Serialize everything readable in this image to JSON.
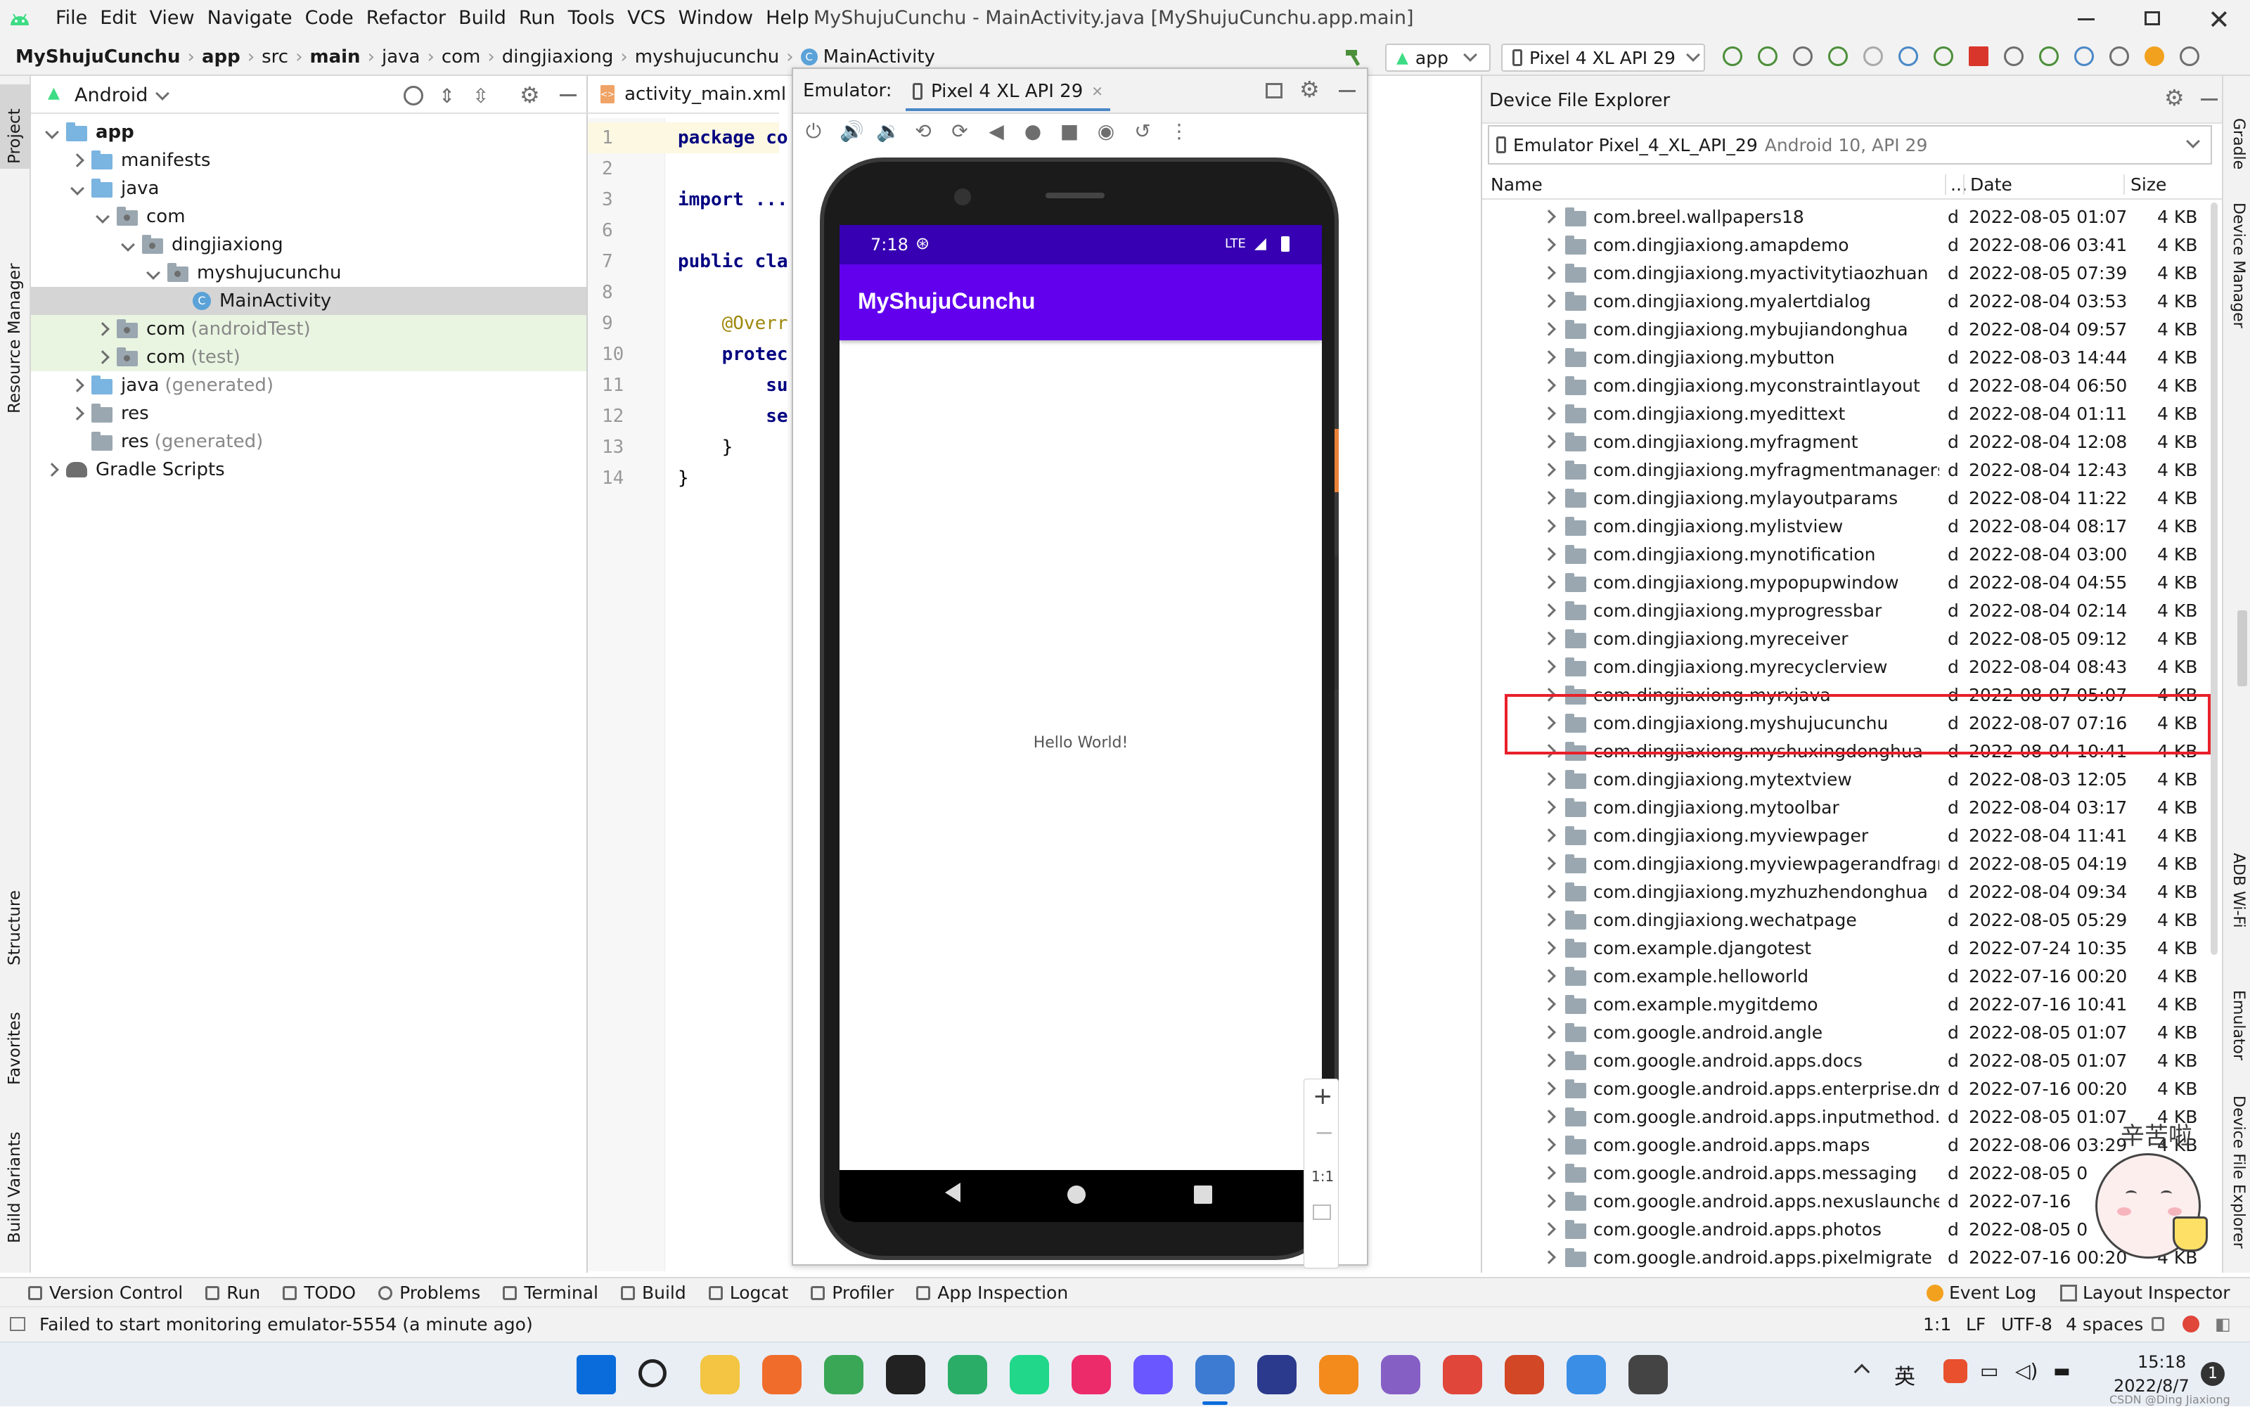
{
  "window": {
    "title": "MyShujuCunchu - MainActivity.java [MyShujuCunchu.app.main]",
    "menus": [
      "File",
      "Edit",
      "View",
      "Navigate",
      "Code",
      "Refactor",
      "Build",
      "Run",
      "Tools",
      "VCS",
      "Window",
      "Help"
    ]
  },
  "breadcrumb": [
    "MyShujuCunchu",
    "app",
    "src",
    "main",
    "java",
    "com",
    "dingjiaxiong",
    "myshujucunchu",
    "MainActivity"
  ],
  "toolbar": {
    "run_config": "app",
    "device": "Pixel 4 XL API 29"
  },
  "left_strip": [
    "Project",
    "Resource Manager",
    "Structure",
    "Favorites",
    "Build Variants"
  ],
  "right_strip": [
    "Gradle",
    "Device Manager",
    "ADB Wi-Fi",
    "Emulator",
    "Device File Explorer"
  ],
  "project": {
    "view": "Android",
    "tree": [
      {
        "label": "app",
        "depth": 0,
        "expanded": true,
        "icon": "folder-module",
        "bold": true
      },
      {
        "label": "manifests",
        "depth": 1,
        "expanded": false,
        "icon": "folder-blue"
      },
      {
        "label": "java",
        "depth": 1,
        "expanded": true,
        "icon": "folder-blue"
      },
      {
        "label": "com",
        "depth": 2,
        "expanded": true,
        "icon": "package"
      },
      {
        "label": "dingjiaxiong",
        "depth": 3,
        "expanded": true,
        "icon": "package"
      },
      {
        "label": "myshujucunchu",
        "depth": 4,
        "expanded": true,
        "icon": "package"
      },
      {
        "label": "MainActivity",
        "depth": 5,
        "icon": "class",
        "selected": true
      },
      {
        "label": "com",
        "suffix": "(androidTest)",
        "depth": 2,
        "expanded": false,
        "icon": "package",
        "green": true
      },
      {
        "label": "com",
        "suffix": "(test)",
        "depth": 2,
        "expanded": false,
        "icon": "package",
        "green": true
      },
      {
        "label": "java",
        "suffix": "(generated)",
        "depth": 1,
        "expanded": false,
        "icon": "folder-blue"
      },
      {
        "label": "res",
        "depth": 1,
        "expanded": false,
        "icon": "folder-res"
      },
      {
        "label": "res",
        "suffix": "(generated)",
        "depth": 1,
        "icon": "folder-res"
      },
      {
        "label": "Gradle Scripts",
        "depth": 0,
        "expanded": false,
        "icon": "gradle"
      }
    ]
  },
  "editor": {
    "tab": "activity_main.xml",
    "lines": [
      {
        "n": "1",
        "html": "package co"
      },
      {
        "n": "2",
        "html": ""
      },
      {
        "n": "3",
        "html": "import ..."
      },
      {
        "n": "6",
        "html": ""
      },
      {
        "n": "7",
        "html": "public cla"
      },
      {
        "n": "8",
        "html": ""
      },
      {
        "n": "9",
        "html": "    @Overr"
      },
      {
        "n": "10",
        "html": "    protec"
      },
      {
        "n": "11",
        "html": "        su"
      },
      {
        "n": "12",
        "html": "        se"
      },
      {
        "n": "13",
        "html": "    }"
      },
      {
        "n": "14",
        "html": "}"
      }
    ]
  },
  "emulator": {
    "label": "Emulator:",
    "tab": "Pixel 4 XL API 29",
    "time": "7:18",
    "network": "LTE",
    "app_title": "MyShujuCunchu",
    "content": "Hello World!",
    "zoom_label": "1:1"
  },
  "device_explorer": {
    "title": "Device File Explorer",
    "device": "Emulator Pixel_4_XL_API_29",
    "device_detail": "Android 10, API 29",
    "columns": {
      "name": "Name",
      "perm": "...",
      "date": "Date",
      "size": "Size"
    },
    "rows": [
      {
        "name": "com.breel.wallpapers18",
        "perm": "d",
        "date": "2022-08-05 01:07",
        "size": "4 KB"
      },
      {
        "name": "com.dingjiaxiong.amapdemo",
        "perm": "d",
        "date": "2022-08-06 03:41",
        "size": "4 KB"
      },
      {
        "name": "com.dingjiaxiong.myactivitytiaozhuan",
        "perm": "d",
        "date": "2022-08-05 07:39",
        "size": "4 KB"
      },
      {
        "name": "com.dingjiaxiong.myalertdialog",
        "perm": "d",
        "date": "2022-08-04 03:53",
        "size": "4 KB"
      },
      {
        "name": "com.dingjiaxiong.mybujiandonghua",
        "perm": "d",
        "date": "2022-08-04 09:57",
        "size": "4 KB"
      },
      {
        "name": "com.dingjiaxiong.mybutton",
        "perm": "d",
        "date": "2022-08-03 14:44",
        "size": "4 KB"
      },
      {
        "name": "com.dingjiaxiong.myconstraintlayout",
        "perm": "d",
        "date": "2022-08-04 06:50",
        "size": "4 KB"
      },
      {
        "name": "com.dingjiaxiong.myedittext",
        "perm": "d",
        "date": "2022-08-04 01:11",
        "size": "4 KB"
      },
      {
        "name": "com.dingjiaxiong.myfragment",
        "perm": "d",
        "date": "2022-08-04 12:08",
        "size": "4 KB"
      },
      {
        "name": "com.dingjiaxiong.myfragmentmanagers",
        "perm": "d",
        "date": "2022-08-04 12:43",
        "size": "4 KB"
      },
      {
        "name": "com.dingjiaxiong.mylayoutparams",
        "perm": "d",
        "date": "2022-08-04 11:22",
        "size": "4 KB"
      },
      {
        "name": "com.dingjiaxiong.mylistview",
        "perm": "d",
        "date": "2022-08-04 08:17",
        "size": "4 KB"
      },
      {
        "name": "com.dingjiaxiong.mynotification",
        "perm": "d",
        "date": "2022-08-04 03:00",
        "size": "4 KB"
      },
      {
        "name": "com.dingjiaxiong.mypopupwindow",
        "perm": "d",
        "date": "2022-08-04 04:55",
        "size": "4 KB"
      },
      {
        "name": "com.dingjiaxiong.myprogressbar",
        "perm": "d",
        "date": "2022-08-04 02:14",
        "size": "4 KB"
      },
      {
        "name": "com.dingjiaxiong.myreceiver",
        "perm": "d",
        "date": "2022-08-05 09:12",
        "size": "4 KB"
      },
      {
        "name": "com.dingjiaxiong.myrecyclerview",
        "perm": "d",
        "date": "2022-08-04 08:43",
        "size": "4 KB"
      },
      {
        "name": "com.dingjiaxiong.myrxjava",
        "perm": "d",
        "date": "2022-08-07 05:07",
        "size": "4 KB"
      },
      {
        "name": "com.dingjiaxiong.myshujucunchu",
        "perm": "d",
        "date": "2022-08-07 07:16",
        "size": "4 KB",
        "highlight": true
      },
      {
        "name": "com.dingjiaxiong.myshuxingdonghua",
        "perm": "d",
        "date": "2022-08-04 10:41",
        "size": "4 KB"
      },
      {
        "name": "com.dingjiaxiong.mytextview",
        "perm": "d",
        "date": "2022-08-03 12:05",
        "size": "4 KB"
      },
      {
        "name": "com.dingjiaxiong.mytoolbar",
        "perm": "d",
        "date": "2022-08-04 03:17",
        "size": "4 KB"
      },
      {
        "name": "com.dingjiaxiong.myviewpager",
        "perm": "d",
        "date": "2022-08-04 11:41",
        "size": "4 KB"
      },
      {
        "name": "com.dingjiaxiong.myviewpagerandfragmen",
        "perm": "d",
        "date": "2022-08-05 04:19",
        "size": "4 KB"
      },
      {
        "name": "com.dingjiaxiong.myzhuzhendonghua",
        "perm": "d",
        "date": "2022-08-04 09:34",
        "size": "4 KB"
      },
      {
        "name": "com.dingjiaxiong.wechatpage",
        "perm": "d",
        "date": "2022-08-05 05:29",
        "size": "4 KB"
      },
      {
        "name": "com.example.djangotest",
        "perm": "d",
        "date": "2022-07-24 10:35",
        "size": "4 KB"
      },
      {
        "name": "com.example.helloworld",
        "perm": "d",
        "date": "2022-07-16 00:20",
        "size": "4 KB"
      },
      {
        "name": "com.example.mygitdemo",
        "perm": "d",
        "date": "2022-07-16 10:41",
        "size": "4 KB"
      },
      {
        "name": "com.google.android.angle",
        "perm": "d",
        "date": "2022-08-05 01:07",
        "size": "4 KB"
      },
      {
        "name": "com.google.android.apps.docs",
        "perm": "d",
        "date": "2022-08-05 01:07",
        "size": "4 KB"
      },
      {
        "name": "com.google.android.apps.enterprise.dmage",
        "perm": "d",
        "date": "2022-07-16 00:20",
        "size": "4 KB"
      },
      {
        "name": "com.google.android.apps.inputmethod.hinc",
        "perm": "d",
        "date": "2022-08-05 01:07",
        "size": "4 KB"
      },
      {
        "name": "com.google.android.apps.maps",
        "perm": "d",
        "date": "2022-08-06 03:29",
        "size": "4 KB"
      },
      {
        "name": "com.google.android.apps.messaging",
        "perm": "d",
        "date": "2022-08-05 0",
        "size": ""
      },
      {
        "name": "com.google.android.apps.nexuslauncher",
        "perm": "d",
        "date": "2022-07-16",
        "size": ""
      },
      {
        "name": "com.google.android.apps.photos",
        "perm": "d",
        "date": "2022-08-05 0",
        "size": ""
      },
      {
        "name": "com.google.android.apps.pixelmigrate",
        "perm": "d",
        "date": "2022-07-16 00:20",
        "size": "4 KB"
      }
    ]
  },
  "bottom_tabs": [
    "Version Control",
    "Run",
    "TODO",
    "Problems",
    "Terminal",
    "Build",
    "Logcat",
    "Profiler",
    "App Inspection"
  ],
  "bottom_right": [
    "Event Log",
    "Layout Inspector"
  ],
  "status": {
    "message": "Failed to start monitoring emulator-5554 (a minute ago)",
    "caret": "1:1",
    "line_sep": "LF",
    "encoding": "UTF-8",
    "indent": "4 spaces"
  },
  "taskbar": {
    "time": "15:18",
    "date": "2022/8/7",
    "ime": "英",
    "watermark": "CSDN @Ding Jiaxiong"
  },
  "sticker": {
    "text": "辛苦啦"
  },
  "colors": {
    "accent": "#6200ee",
    "highlight_box": "#e8202a",
    "selection": "#d5d5d5",
    "tree_green": "#e9f5e1",
    "keyword": "#000080"
  }
}
